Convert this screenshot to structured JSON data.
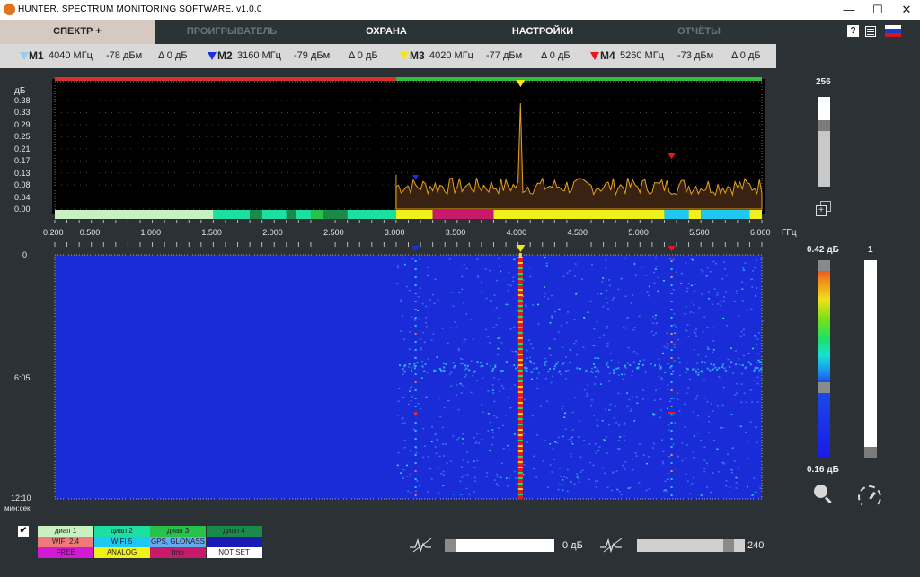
{
  "app": {
    "title": "HUNTER. SPECTRUM MONITORING SOFTWARE. v1.0.0",
    "window_controls": [
      "—",
      "☐",
      "✕"
    ]
  },
  "tabs": [
    {
      "label": "СПЕКТР +",
      "active": true
    },
    {
      "label": "ПРОИГРЫВАТЕЛЬ",
      "active": false
    },
    {
      "label": "ОХРАНА",
      "active": false
    },
    {
      "label": "НАСТРОЙКИ",
      "active": false
    },
    {
      "label": "ОТЧЁТЫ",
      "active": false
    }
  ],
  "markers": [
    {
      "name": "M1",
      "freq": "4040 МГц",
      "level": "-78 дБм",
      "delta": "Δ 0 дБ",
      "color": "#9ecae9"
    },
    {
      "name": "M2",
      "freq": "3160 МГц",
      "level": "-79 дБм",
      "delta": "Δ 0 дБ",
      "color": "#1a2ee8"
    },
    {
      "name": "M3",
      "freq": "4020 МГц",
      "level": "-77 дБм",
      "delta": "Δ 0 дБ",
      "color": "#f2e51c"
    },
    {
      "name": "M4",
      "freq": "5260 МГц",
      "level": "-73 дБм",
      "delta": "Δ 0 дБ",
      "color": "#e8171a"
    }
  ],
  "spectrum": {
    "y_unit": "дБ",
    "y_ticks": [
      "0.38",
      "0.33",
      "0.29",
      "0.25",
      "0.21",
      "0.17",
      "0.13",
      "0.08",
      "0.04",
      "0.00"
    ],
    "x_unit": "ГГц",
    "x_ticks": [
      "0.200",
      "0.500",
      "1.000",
      "1.500",
      "2.000",
      "2.500",
      "3.000",
      "3.500",
      "4.000",
      "4.500",
      "5.000",
      "5.500",
      "6.000"
    ],
    "peak_freq_ghz": 4.02
  },
  "waterfall": {
    "time_unit": "мин:сек",
    "time_ticks": [
      "0",
      "6:05",
      "12:10"
    ]
  },
  "right_panel": {
    "spectrum_scale_top": "256",
    "color_scale_max": "0.42 дБ",
    "color_scale_min": "0.16 дБ",
    "speed_value": "1"
  },
  "legend": [
    {
      "label": "диап 1",
      "color": "#c8f0c0"
    },
    {
      "label": "диап 2",
      "color": "#1de0a0"
    },
    {
      "label": "диап 3",
      "color": "#27c24a"
    },
    {
      "label": "диап 4",
      "color": "#1a8a4a"
    },
    {
      "label": "WIFI 2.4",
      "color": "#f07a7a"
    },
    {
      "label": "WIFI 5",
      "color": "#1ec8f0"
    },
    {
      "label": "GPS, GLONASS",
      "color": "#66aaf0"
    },
    {
      "label": "",
      "color": "#1a1ab4"
    },
    {
      "label": "FREE",
      "color": "#d21ad2"
    },
    {
      "label": "ANALOG",
      "color": "#f0f01a"
    },
    {
      "label": "tmp",
      "color": "#c81a6a"
    },
    {
      "label": "NOT SET",
      "color": "#ffffff"
    }
  ],
  "bottom": {
    "gain_value": "0 дБ",
    "threshold_value": "240",
    "gain_level": 1.0,
    "threshold_level": 0.85,
    "legend_checked": true
  }
}
